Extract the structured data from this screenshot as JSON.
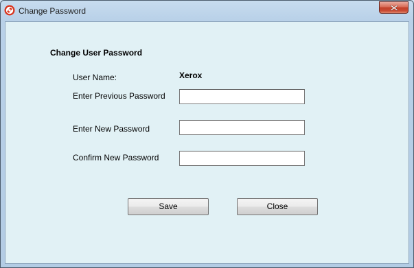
{
  "window": {
    "title": "Change Password",
    "app_icon": "app-logo-icon",
    "close_icon": "close-icon"
  },
  "form": {
    "heading": "Change User Password",
    "user_name_label": "User Name:",
    "user_name_value": "Xerox",
    "previous_password_label": "Enter Previous Password",
    "previous_password_value": "",
    "new_password_label": "Enter New Password",
    "new_password_value": "",
    "confirm_password_label": "Confirm New Password",
    "confirm_password_value": ""
  },
  "buttons": {
    "save_label": "Save",
    "close_label": "Close"
  },
  "colors": {
    "client_background": "#e1f1f5",
    "title_bar": "#c7dcef",
    "close_button": "#c94b34"
  }
}
